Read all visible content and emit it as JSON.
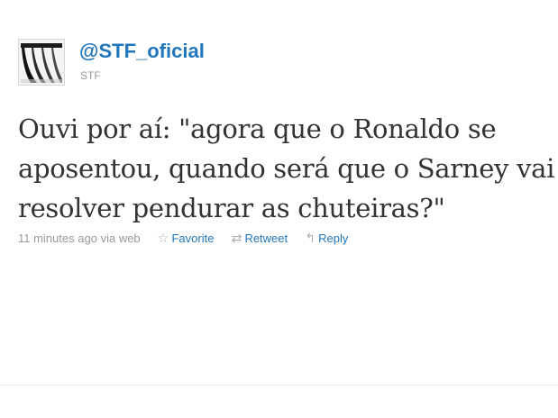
{
  "tweet": {
    "screen_name": "@STF_oficial",
    "full_name": "STF",
    "avatar_icon": "building-colonnade-icon",
    "text_lines": [
      "Ouvi por aí: \"agora que o Ronaldo se",
      "aposentou, quando será que o Sarney vai",
      "resolver pendurar as chuteiras?\""
    ],
    "timestamp": "11 minutes ago",
    "via_prefix": "via",
    "source": "web"
  },
  "actions": {
    "favorite_label": "Favorite",
    "favorite_icon": "star-outline-icon",
    "retweet_label": "Retweet",
    "retweet_icon": "retweet-arrows-icon",
    "reply_label": "Reply",
    "reply_icon": "reply-arrow-icon"
  },
  "colors": {
    "link": "#2276bb",
    "text": "#333333",
    "muted": "#999999"
  }
}
